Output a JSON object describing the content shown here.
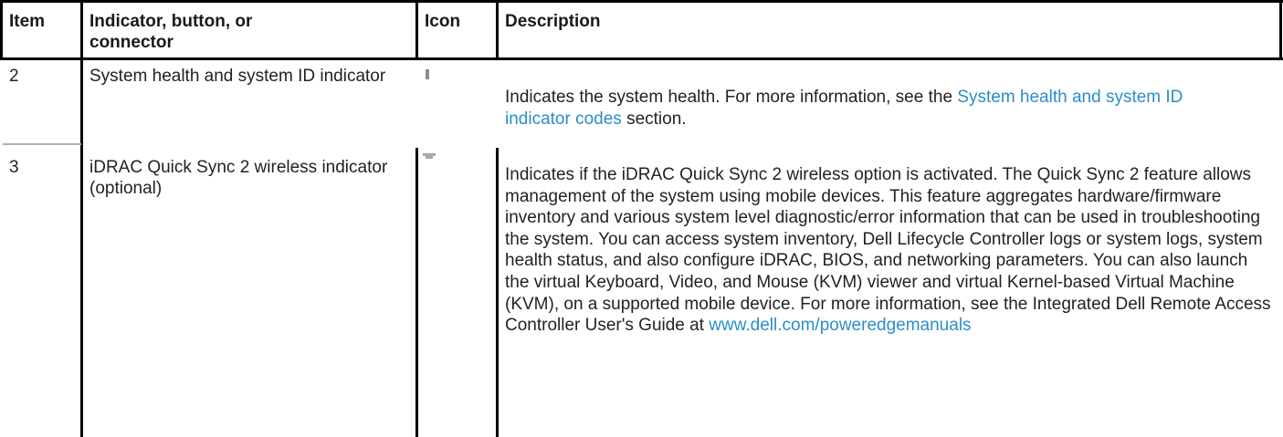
{
  "table": {
    "headers": {
      "item": "Item",
      "indicator": "Indicator, button, or connector",
      "icon": "Icon",
      "description": "Description"
    },
    "rows": [
      {
        "item": "2",
        "indicator": "System health and system ID indicator",
        "icon_name": "system-health-icon",
        "description_before": "Indicates the system health. For more information, see the ",
        "description_link": "System health and system ID indicator codes",
        "description_after": " section."
      },
      {
        "item": "3",
        "indicator": "iDRAC Quick Sync 2 wireless indicator (optional)",
        "icon_name": "wireless-icon",
        "description_before": "Indicates if the iDRAC Quick Sync 2 wireless option is activated. The Quick Sync 2 feature allows management of the system using mobile devices. This feature aggregates hardware/firmware inventory and various system level diagnostic/error information that can be used in troubleshooting the system. You can access system inventory, Dell Lifecycle Controller logs or system logs, system health status, and also configure iDRAC, BIOS, and networking parameters. You can also launch the virtual Keyboard, Video, and Mouse (KVM) viewer and virtual Kernel-based Virtual Machine (KVM), on a supported mobile device. For more information, see the Integrated Dell Remote Access Controller User's Guide at ",
        "description_link": "www.dell.com/poweredgemanuals",
        "description_after": ""
      }
    ],
    "colors": {
      "link": "#2a8fc7",
      "text": "#222222",
      "border": "#000000"
    }
  }
}
